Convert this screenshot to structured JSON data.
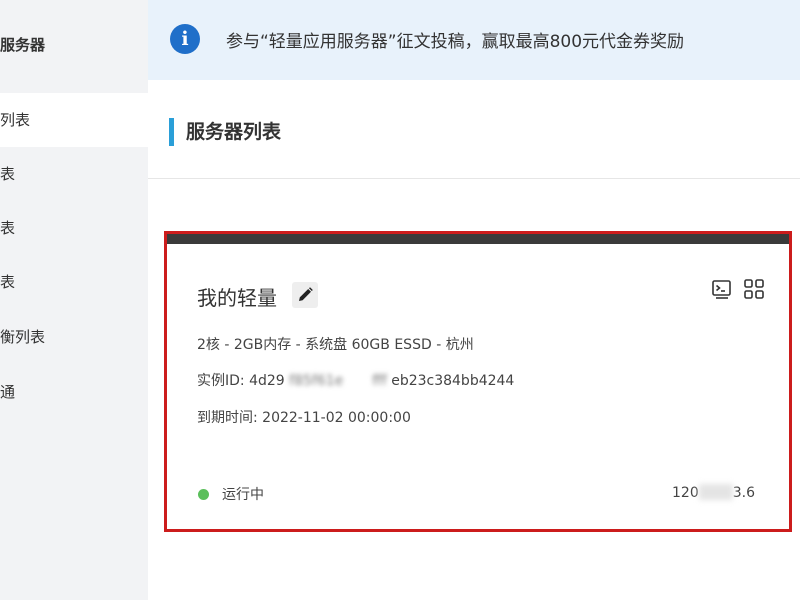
{
  "sidebar": {
    "title": "服务器",
    "items": [
      {
        "label": "列表",
        "active": true
      },
      {
        "label": "表"
      },
      {
        "label": "表"
      },
      {
        "label": "表"
      },
      {
        "label": "衡列表"
      },
      {
        "label": "通"
      }
    ]
  },
  "notice": {
    "icon": "info-icon",
    "text": "参与“轻量应用服务器”征文投稿，赢取最高800元代金券奖励"
  },
  "page": {
    "title": "服务器列表",
    "accent_color": "#2a9fd8"
  },
  "card": {
    "name": "我的轻量",
    "highlight_color": "#cc1c1c",
    "spec": "2核 - 2GB内存 - 系统盘 60GB ESSD - 杭州",
    "instance_label": "实例ID:",
    "instance_prefix": "4d29",
    "instance_blur_1": "f85f61e",
    "instance_blur_2": "fff",
    "instance_suffix": "eb23c384bb4244",
    "expiry_label": "到期时间:",
    "expiry_value": "2022-11-02 00:00:00",
    "status": "运行中",
    "status_color": "#5bbf5b",
    "ip_prefix": "120",
    "ip_suffix": "3.6",
    "icons": [
      "edit-icon",
      "terminal-icon",
      "grid-icon"
    ]
  }
}
